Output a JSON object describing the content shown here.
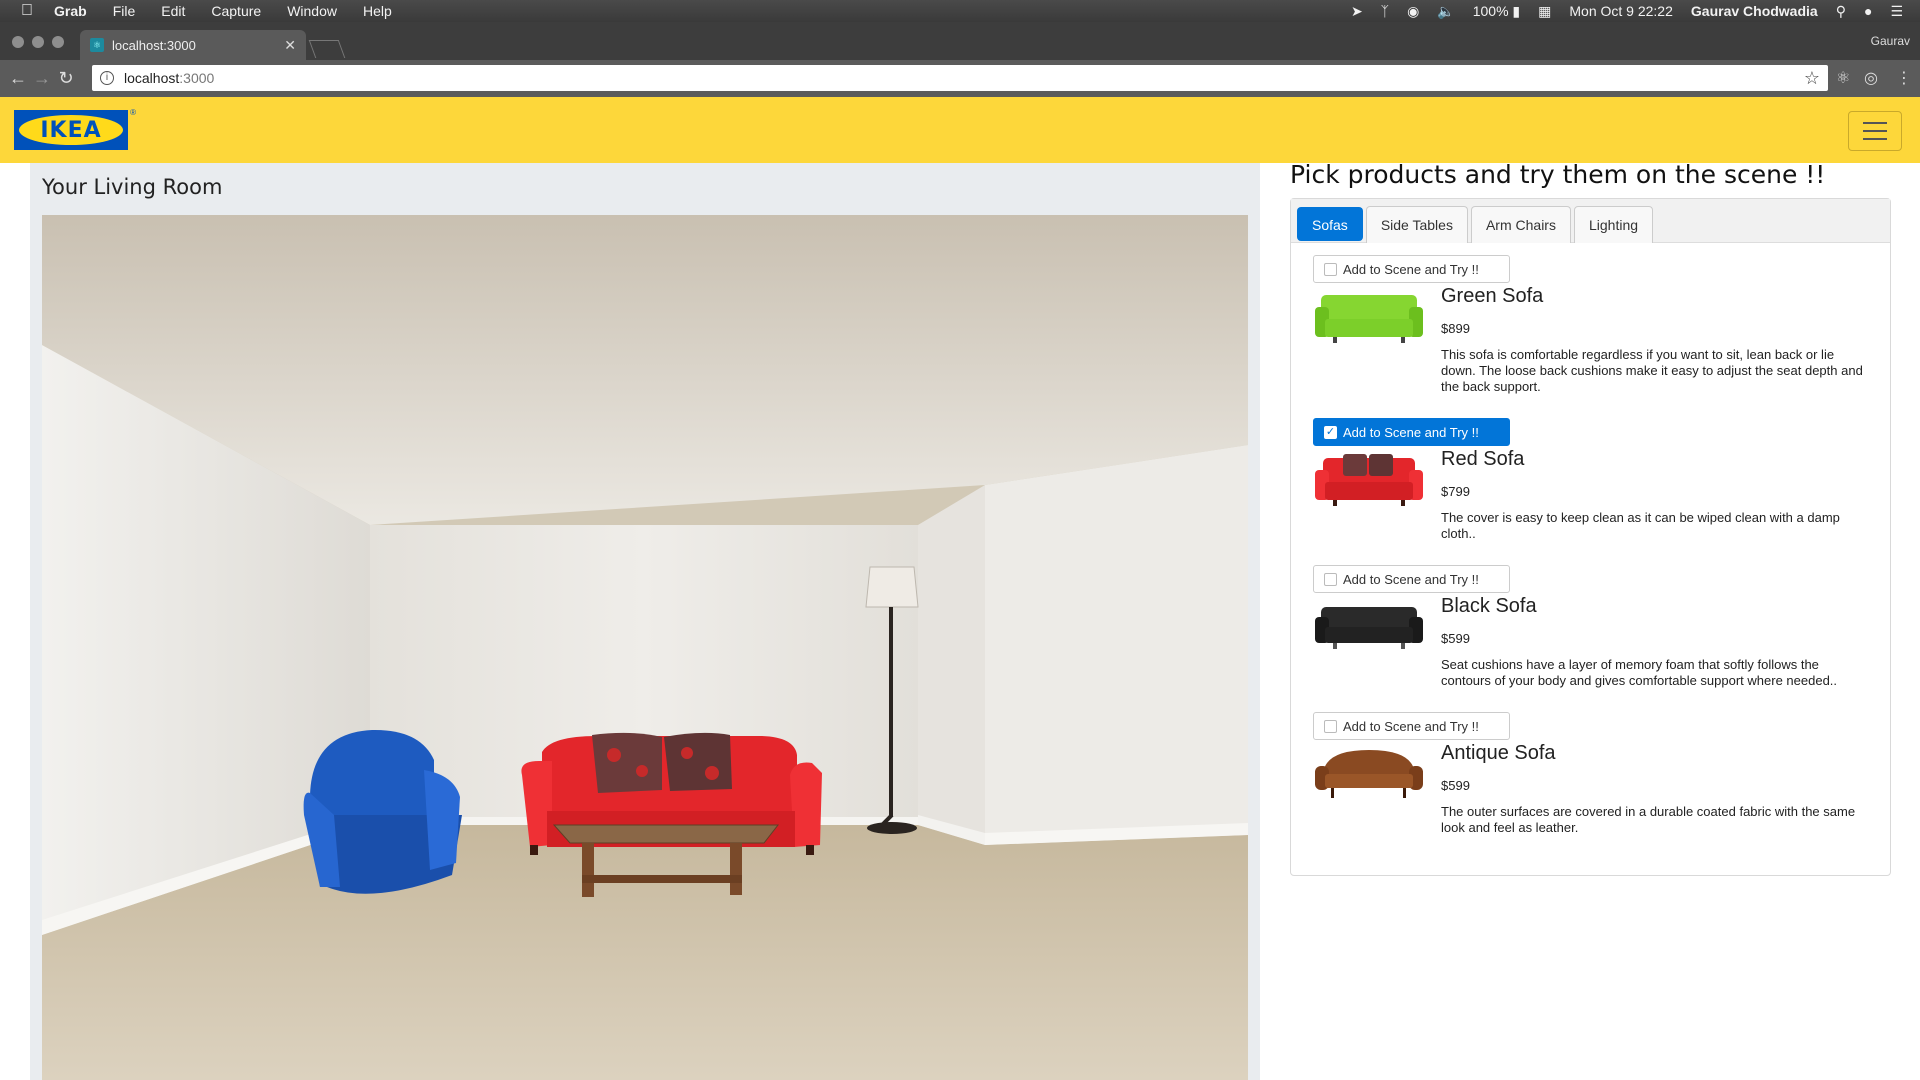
{
  "menubar": {
    "app": "Grab",
    "menus": [
      "File",
      "Edit",
      "Capture",
      "Window",
      "Help"
    ],
    "battery": "100%",
    "datetime": "Mon Oct 9  22:22",
    "user": "Gaurav Chodwadia"
  },
  "browser": {
    "tab_title": "localhost:3000",
    "profile": "Gaurav",
    "url_host": "localhost",
    "url_port": ":3000"
  },
  "scene": {
    "title": "Your Living Room"
  },
  "products_panel": {
    "title": "Pick products and try them on the scene !!",
    "tabs": [
      "Sofas",
      "Side Tables",
      "Arm Chairs",
      "Lighting"
    ],
    "active_tab": "Sofas",
    "try_label": "Add to Scene and Try !!",
    "items": [
      {
        "name": "Green Sofa",
        "price": "$899",
        "checked": false,
        "color": "#7ccf2a",
        "desc": "This sofa is comfortable regardless if you want to sit, lean back or lie down. The loose back cushions make it easy to adjust the seat depth and the back support."
      },
      {
        "name": "Red Sofa",
        "price": "$799",
        "checked": true,
        "color": "#e8262a",
        "desc": "The cover is easy to keep clean as it can be wiped clean with a damp cloth.."
      },
      {
        "name": "Black Sofa",
        "price": "$599",
        "checked": false,
        "color": "#1e1e1e",
        "desc": "Seat cushions have a layer of memory foam that softly follows the contours of your body and gives comfortable support where needed.."
      },
      {
        "name": "Antique Sofa",
        "price": "$599",
        "checked": false,
        "color": "#8a4a22",
        "desc": "The outer surfaces are covered in a durable coated fabric with the same look and feel as leather."
      }
    ]
  },
  "colors": {
    "brand_yellow": "#fdd73a",
    "brand_blue": "#0051ba",
    "accent": "#0275d8"
  }
}
